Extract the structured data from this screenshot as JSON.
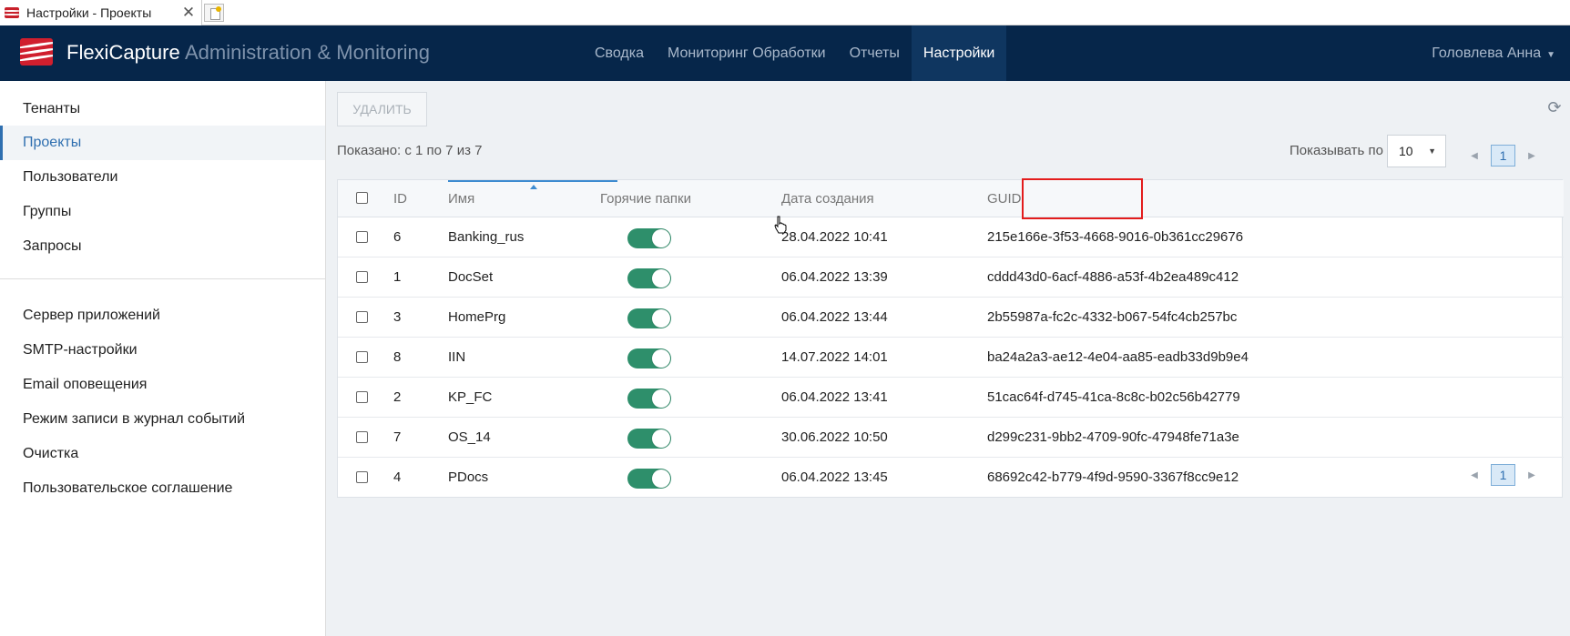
{
  "browser": {
    "tab_title": "Настройки - Проекты",
    "close_glyph": "✕"
  },
  "header": {
    "brand": "FlexiCapture",
    "brand_sub": "Administration & Monitoring",
    "nav": [
      "Сводка",
      "Мониторинг Обработки",
      "Отчеты",
      "Настройки"
    ],
    "active_nav": "Настройки",
    "user": "Головлева Анна"
  },
  "sidebar": {
    "group1": [
      "Тенанты",
      "Проекты",
      "Пользователи",
      "Группы",
      "Запросы"
    ],
    "group2": [
      "Сервер приложений",
      "SMTP-настройки",
      "Email оповещения",
      "Режим записи в журнал событий",
      "Очистка",
      "Пользовательское соглашение"
    ],
    "active": "Проекты"
  },
  "toolbar": {
    "delete_label": "УДАЛИТЬ",
    "refresh_icon": "refresh-icon"
  },
  "summary": {
    "shown": "Показано: с 1 по 7 из 7",
    "per_page_label": "Показывать по",
    "per_page_value": "10",
    "current_page": "1"
  },
  "table": {
    "headers": {
      "id": "ID",
      "name": "Имя",
      "hot_folders": "Горячие папки",
      "created": "Дата создания",
      "guid": "GUID"
    },
    "rows": [
      {
        "id": "6",
        "name": "Banking_rus",
        "hot": true,
        "created": "28.04.2022 10:41",
        "guid": "215e166e-3f53-4668-9016-0b361cc29676"
      },
      {
        "id": "1",
        "name": "DocSet",
        "hot": true,
        "created": "06.04.2022 13:39",
        "guid": "cddd43d0-6acf-4886-a53f-4b2ea489c412"
      },
      {
        "id": "3",
        "name": "HomePrg",
        "hot": true,
        "created": "06.04.2022 13:44",
        "guid": "2b55987a-fc2c-4332-b067-54fc4cb257bc"
      },
      {
        "id": "8",
        "name": "IIN",
        "hot": true,
        "created": "14.07.2022 14:01",
        "guid": "ba24a2a3-ae12-4e04-aa85-eadb33d9b9e4"
      },
      {
        "id": "2",
        "name": "KP_FC",
        "hot": true,
        "created": "06.04.2022 13:41",
        "guid": "51cac64f-d745-41ca-8c8c-b02c56b42779"
      },
      {
        "id": "7",
        "name": "OS_14",
        "hot": true,
        "created": "30.06.2022 10:50",
        "guid": "d299c231-9bb2-4709-90fc-47948fe71a3e"
      },
      {
        "id": "4",
        "name": "PDocs",
        "hot": true,
        "created": "06.04.2022 13:45",
        "guid": "68692c42-b779-4f9d-9590-3367f8cc9e12"
      }
    ]
  },
  "colors": {
    "header_bg": "#06264a",
    "accent": "#2f6fb0",
    "toggle_on": "#2e8f6b",
    "highlight": "#e31c1c"
  }
}
